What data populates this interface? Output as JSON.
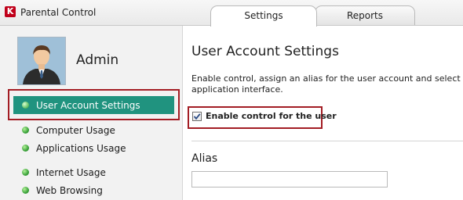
{
  "window": {
    "title": "Parental Control",
    "logo_letter": "K"
  },
  "tabs": [
    {
      "label": "Settings",
      "selected": true
    },
    {
      "label": "Reports",
      "selected": false
    }
  ],
  "sidebar": {
    "user": {
      "name": "Admin"
    },
    "items": [
      {
        "label": "User Account Settings",
        "active": true,
        "status": "green"
      },
      {
        "label": "Computer Usage",
        "active": false,
        "status": "green"
      },
      {
        "label": "Applications Usage",
        "active": false,
        "status": "green"
      },
      {
        "label": "Internet Usage",
        "active": false,
        "status": "green"
      },
      {
        "label": "Web Browsing",
        "active": false,
        "status": "green"
      }
    ]
  },
  "main": {
    "title": "User Account Settings",
    "description_line1": "Enable control, assign an alias for the user account and select an im",
    "description_line2": "application interface.",
    "enable_control": {
      "label": "Enable control for the user",
      "checked": true
    },
    "alias": {
      "label": "Alias",
      "value": ""
    }
  },
  "colors": {
    "active_item_bg": "#20937f",
    "highlight_frame": "#a31d24",
    "status_dot": "#3aa23a"
  }
}
